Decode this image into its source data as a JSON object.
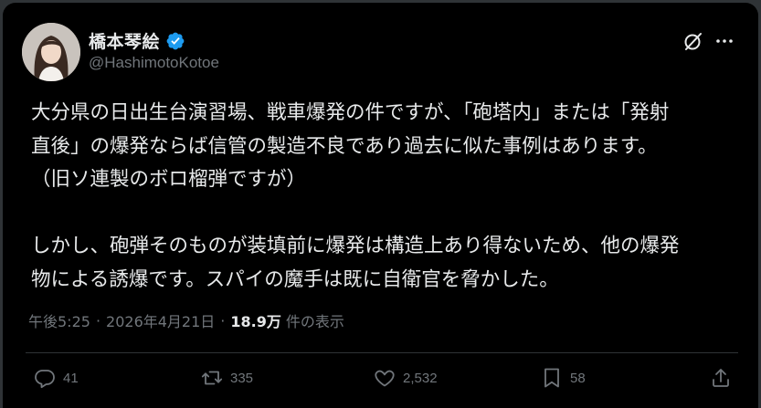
{
  "author": {
    "display_name": "橋本琴絵",
    "handle": "@HashimotoKotoe",
    "verified_icon": "verified-badge-icon",
    "avatar_icon": "profile-photo"
  },
  "header_icons": {
    "grok": "grok-icon",
    "more": "more-horizontal-icon"
  },
  "post": {
    "lines": [
      "大分県の日出生台演習場、戦車爆発の件ですが、「砲塔内」または「発射",
      "直後」の爆発ならば信管の製造不良であり過去に似た事例はあります。",
      "（旧ソ連製のボロ榴弾ですが）",
      "",
      "しかし、砲弾そのものが装填前に爆発は構造上あり得ないため、他の爆発",
      "物による誘爆です。スパイの魔手は既に自衛官を脅かした。"
    ]
  },
  "meta": {
    "time": "午後5:25",
    "separator": "·",
    "date": "2026年4月21日",
    "views": "18.9万",
    "views_label": "件の表示"
  },
  "actions": {
    "reply_count": "41",
    "repost_count": "335",
    "like_count": "2,532",
    "bookmark_count": "58"
  },
  "colors": {
    "background": "#000000",
    "text": "#e7e9ea",
    "secondary": "#71767b",
    "verified": "#1d9bf0",
    "border": "#2f3336"
  }
}
